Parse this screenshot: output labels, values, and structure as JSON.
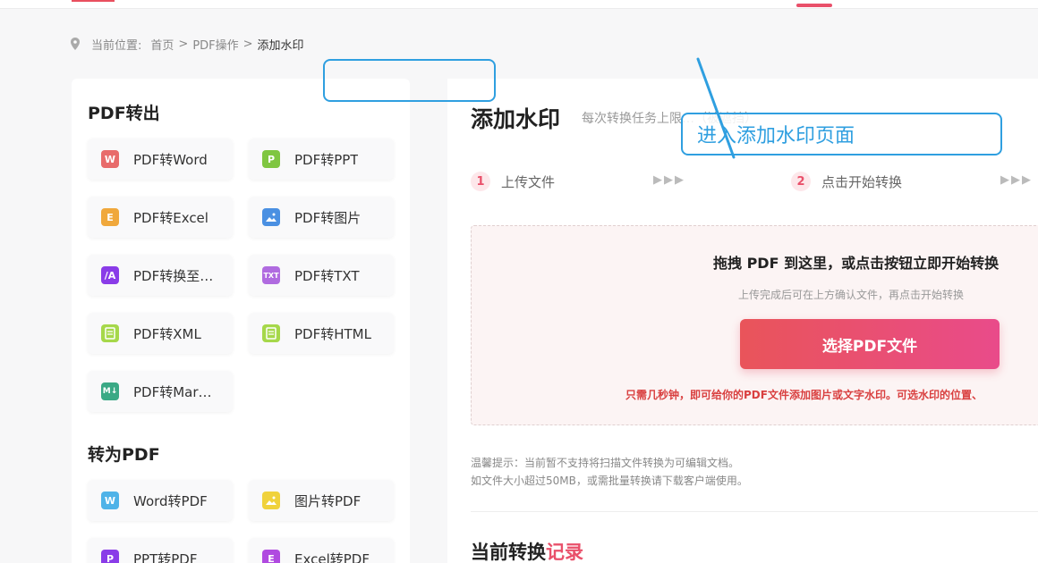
{
  "breadcrumb": {
    "prefix": "当前位置:",
    "items": [
      "首页",
      "PDF操作",
      "添加水印"
    ],
    "separator": ">"
  },
  "sidebar": {
    "section_export": "PDF转出",
    "export_tools": [
      {
        "label": "PDF转Word",
        "icon": "W",
        "color": "#e86b6b"
      },
      {
        "label": "PDF转PPT",
        "icon": "P",
        "color": "#7fc641"
      },
      {
        "label": "PDF转Excel",
        "icon": "E",
        "color": "#f0a83c"
      },
      {
        "label": "PDF转图片",
        "icon": "image",
        "color": "#4a90e2"
      },
      {
        "label": "PDF转换至…",
        "icon": "/A",
        "color": "#8a3ce8"
      },
      {
        "label": "PDF转TXT",
        "icon": "TXT",
        "color": "#b06be0"
      },
      {
        "label": "PDF转XML",
        "icon": "xml",
        "color": "#a6d84a"
      },
      {
        "label": "PDF转HTML",
        "icon": "html",
        "color": "#a6d84a"
      },
      {
        "label": "PDF转Mar…",
        "icon": "M↓",
        "color": "#3aa985"
      }
    ],
    "section_import": "转为PDF",
    "import_tools": [
      {
        "label": "Word转PDF",
        "icon": "W",
        "color": "#4fb3e8"
      },
      {
        "label": "图片转PDF",
        "icon": "image",
        "color": "#f0d23c"
      },
      {
        "label": "PPT转PDF",
        "icon": "P",
        "color": "#8a3ce8"
      },
      {
        "label": "Excel转PDF",
        "icon": "E",
        "color": "#b04ae0"
      }
    ]
  },
  "main": {
    "title": "添加水印",
    "subtitle": "每次转换任务上限…（被遮挡）",
    "steps": [
      {
        "num": "1",
        "label": "上传文件"
      },
      {
        "num": "2",
        "label": "点击开始转换"
      }
    ],
    "step_arrows": "▶▶▶",
    "dropzone": {
      "title": "拖拽 PDF 到这里，或点击按钮立即开始转换",
      "subtitle": "上传完成后可在上方确认文件，再点击开始转换",
      "button": "选择PDF文件",
      "note": "只需几秒钟，即可给你的PDF文件添加图片或文字水印。可选水印的位置、"
    },
    "tips": [
      "温馨提示：当前暂不支持将扫描文件转换为可编辑文档。",
      "如文件大小超过50MB，或需批量转换请下载客户端使用。"
    ],
    "records_title": "当前转换",
    "records_highlight": "记录"
  },
  "annotation": {
    "text": "进入添加水印页面",
    "color": "#2f9fe0"
  },
  "colors": {
    "accent": "#e9506a",
    "annotation": "#2f9fe0"
  }
}
